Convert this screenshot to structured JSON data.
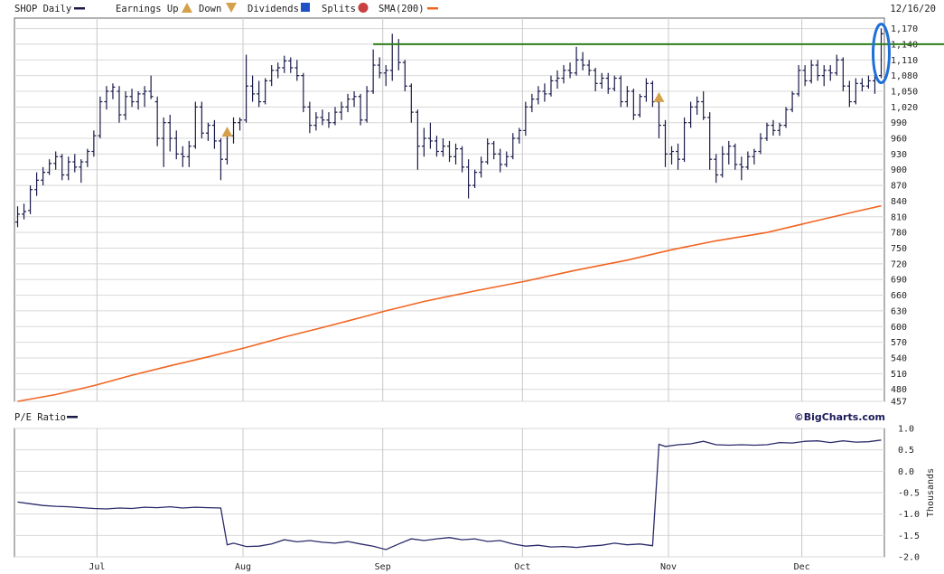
{
  "chart_data": [
    {
      "type": "ohlc",
      "legend": {
        "symbol_label": "SHOP Daily",
        "earnings_label": "Earnings Up",
        "down_label": "Down",
        "dividends_label": "Dividends",
        "splits_label": "Splits",
        "sma_label": "SMA(200)",
        "date_label": "12/16/20"
      },
      "colors": {
        "bars": "#1a1a4a",
        "sma": "#f26522",
        "resistance": "#2e7d1a",
        "highlight": "#1e6fd9",
        "earnings": "#d4a04a",
        "dividends": "#2050c8",
        "splits": "#c84040",
        "grid": "#d8d8d8"
      },
      "ylim": [
        457,
        1190
      ],
      "y_ticks": [
        457,
        480,
        510,
        540,
        570,
        600,
        630,
        660,
        690,
        720,
        750,
        780,
        810,
        840,
        870,
        900,
        930,
        960,
        990,
        1020,
        1050,
        1080,
        1110,
        1140,
        1170
      ],
      "x_months": [
        {
          "label": "Jul",
          "day": 13
        },
        {
          "label": "Aug",
          "day": 36
        },
        {
          "label": "Sep",
          "day": 58
        },
        {
          "label": "Oct",
          "day": 80
        },
        {
          "label": "Nov",
          "day": 103
        },
        {
          "label": "Dec",
          "day": 124
        }
      ],
      "num_days": 137,
      "ohlc": [
        {
          "o": 800,
          "h": 830,
          "l": 790,
          "c": 815
        },
        {
          "o": 815,
          "h": 835,
          "l": 805,
          "c": 820
        },
        {
          "o": 822,
          "h": 870,
          "l": 815,
          "c": 862
        },
        {
          "o": 862,
          "h": 895,
          "l": 850,
          "c": 880
        },
        {
          "o": 880,
          "h": 905,
          "l": 870,
          "c": 895
        },
        {
          "o": 895,
          "h": 920,
          "l": 890,
          "c": 912
        },
        {
          "o": 912,
          "h": 935,
          "l": 900,
          "c": 925
        },
        {
          "o": 925,
          "h": 930,
          "l": 880,
          "c": 890
        },
        {
          "o": 890,
          "h": 925,
          "l": 880,
          "c": 915
        },
        {
          "o": 915,
          "h": 930,
          "l": 895,
          "c": 905
        },
        {
          "o": 905,
          "h": 920,
          "l": 875,
          "c": 915
        },
        {
          "o": 915,
          "h": 940,
          "l": 905,
          "c": 935
        },
        {
          "o": 935,
          "h": 975,
          "l": 925,
          "c": 965
        },
        {
          "o": 965,
          "h": 1040,
          "l": 960,
          "c": 1030
        },
        {
          "o": 1030,
          "h": 1060,
          "l": 1015,
          "c": 1050
        },
        {
          "o": 1050,
          "h": 1065,
          "l": 1035,
          "c": 1058
        },
        {
          "o": 1050,
          "h": 1060,
          "l": 990,
          "c": 1005
        },
        {
          "o": 1005,
          "h": 1050,
          "l": 995,
          "c": 1040
        },
        {
          "o": 1040,
          "h": 1055,
          "l": 1020,
          "c": 1030
        },
        {
          "o": 1030,
          "h": 1050,
          "l": 1015,
          "c": 1045
        },
        {
          "o": 1045,
          "h": 1060,
          "l": 1020,
          "c": 1050
        },
        {
          "o": 1050,
          "h": 1080,
          "l": 1035,
          "c": 1040
        },
        {
          "o": 1030,
          "h": 1040,
          "l": 945,
          "c": 960
        },
        {
          "o": 960,
          "h": 1000,
          "l": 905,
          "c": 990
        },
        {
          "o": 990,
          "h": 1005,
          "l": 935,
          "c": 960
        },
        {
          "o": 960,
          "h": 975,
          "l": 920,
          "c": 930
        },
        {
          "o": 930,
          "h": 945,
          "l": 905,
          "c": 925
        },
        {
          "o": 925,
          "h": 955,
          "l": 905,
          "c": 945
        },
        {
          "o": 945,
          "h": 1030,
          "l": 940,
          "c": 1020
        },
        {
          "o": 1020,
          "h": 1030,
          "l": 960,
          "c": 970
        },
        {
          "o": 970,
          "h": 990,
          "l": 955,
          "c": 985
        },
        {
          "o": 985,
          "h": 995,
          "l": 940,
          "c": 955
        },
        {
          "o": 955,
          "h": 960,
          "l": 880,
          "c": 920
        },
        {
          "o": 920,
          "h": 975,
          "l": 910,
          "c": 965
        },
        {
          "o": 965,
          "h": 1000,
          "l": 950,
          "c": 990
        },
        {
          "o": 990,
          "h": 1000,
          "l": 975,
          "c": 995
        },
        {
          "o": 995,
          "h": 1120,
          "l": 990,
          "c": 1060
        },
        {
          "o": 1060,
          "h": 1080,
          "l": 1030,
          "c": 1045
        },
        {
          "o": 1045,
          "h": 1070,
          "l": 1020,
          "c": 1030
        },
        {
          "o": 1030,
          "h": 1075,
          "l": 1025,
          "c": 1070
        },
        {
          "o": 1070,
          "h": 1100,
          "l": 1060,
          "c": 1090
        },
        {
          "o": 1090,
          "h": 1105,
          "l": 1075,
          "c": 1095
        },
        {
          "o": 1095,
          "h": 1118,
          "l": 1085,
          "c": 1108
        },
        {
          "o": 1108,
          "h": 1115,
          "l": 1085,
          "c": 1095
        },
        {
          "o": 1095,
          "h": 1110,
          "l": 1070,
          "c": 1080
        },
        {
          "o": 1080,
          "h": 1085,
          "l": 1010,
          "c": 1020
        },
        {
          "o": 1020,
          "h": 1030,
          "l": 970,
          "c": 985
        },
        {
          "o": 985,
          "h": 1010,
          "l": 975,
          "c": 1000
        },
        {
          "o": 1000,
          "h": 1015,
          "l": 985,
          "c": 995
        },
        {
          "o": 995,
          "h": 1010,
          "l": 980,
          "c": 990
        },
        {
          "o": 990,
          "h": 1020,
          "l": 985,
          "c": 1010
        },
        {
          "o": 1010,
          "h": 1030,
          "l": 995,
          "c": 1020
        },
        {
          "o": 1020,
          "h": 1045,
          "l": 1010,
          "c": 1035
        },
        {
          "o": 1035,
          "h": 1050,
          "l": 1020,
          "c": 1040
        },
        {
          "o": 1040,
          "h": 1045,
          "l": 985,
          "c": 995
        },
        {
          "o": 995,
          "h": 1060,
          "l": 990,
          "c": 1050
        },
        {
          "o": 1050,
          "h": 1130,
          "l": 1045,
          "c": 1100
        },
        {
          "o": 1100,
          "h": 1115,
          "l": 1075,
          "c": 1085
        },
        {
          "o": 1085,
          "h": 1100,
          "l": 1060,
          "c": 1090
        },
        {
          "o": 1090,
          "h": 1160,
          "l": 1070,
          "c": 1140
        },
        {
          "o": 1140,
          "h": 1150,
          "l": 1090,
          "c": 1105
        },
        {
          "o": 1105,
          "h": 1110,
          "l": 1050,
          "c": 1060
        },
        {
          "o": 1060,
          "h": 1065,
          "l": 990,
          "c": 1010
        },
        {
          "o": 1010,
          "h": 1015,
          "l": 900,
          "c": 945
        },
        {
          "o": 945,
          "h": 980,
          "l": 925,
          "c": 960
        },
        {
          "o": 960,
          "h": 990,
          "l": 940,
          "c": 955
        },
        {
          "o": 955,
          "h": 965,
          "l": 925,
          "c": 935
        },
        {
          "o": 935,
          "h": 960,
          "l": 925,
          "c": 945
        },
        {
          "o": 945,
          "h": 955,
          "l": 915,
          "c": 925
        },
        {
          "o": 925,
          "h": 950,
          "l": 910,
          "c": 940
        },
        {
          "o": 940,
          "h": 945,
          "l": 895,
          "c": 905
        },
        {
          "o": 905,
          "h": 920,
          "l": 845,
          "c": 870
        },
        {
          "o": 870,
          "h": 900,
          "l": 865,
          "c": 895
        },
        {
          "o": 895,
          "h": 925,
          "l": 885,
          "c": 915
        },
        {
          "o": 915,
          "h": 960,
          "l": 910,
          "c": 950
        },
        {
          "o": 950,
          "h": 955,
          "l": 920,
          "c": 930
        },
        {
          "o": 930,
          "h": 940,
          "l": 895,
          "c": 910
        },
        {
          "o": 910,
          "h": 935,
          "l": 905,
          "c": 925
        },
        {
          "o": 925,
          "h": 970,
          "l": 920,
          "c": 960
        },
        {
          "o": 960,
          "h": 980,
          "l": 950,
          "c": 975
        },
        {
          "o": 975,
          "h": 1030,
          "l": 965,
          "c": 1020
        },
        {
          "o": 1020,
          "h": 1045,
          "l": 1010,
          "c": 1035
        },
        {
          "o": 1035,
          "h": 1060,
          "l": 1025,
          "c": 1050
        },
        {
          "o": 1050,
          "h": 1065,
          "l": 1030,
          "c": 1045
        },
        {
          "o": 1045,
          "h": 1080,
          "l": 1040,
          "c": 1070
        },
        {
          "o": 1070,
          "h": 1090,
          "l": 1055,
          "c": 1075
        },
        {
          "o": 1075,
          "h": 1100,
          "l": 1065,
          "c": 1090
        },
        {
          "o": 1090,
          "h": 1105,
          "l": 1075,
          "c": 1085
        },
        {
          "o": 1085,
          "h": 1135,
          "l": 1080,
          "c": 1110
        },
        {
          "o": 1110,
          "h": 1125,
          "l": 1090,
          "c": 1100
        },
        {
          "o": 1100,
          "h": 1110,
          "l": 1080,
          "c": 1090
        },
        {
          "o": 1090,
          "h": 1095,
          "l": 1050,
          "c": 1065
        },
        {
          "o": 1065,
          "h": 1085,
          "l": 1055,
          "c": 1075
        },
        {
          "o": 1075,
          "h": 1085,
          "l": 1045,
          "c": 1055
        },
        {
          "o": 1055,
          "h": 1080,
          "l": 1050,
          "c": 1075
        },
        {
          "o": 1075,
          "h": 1080,
          "l": 1020,
          "c": 1030
        },
        {
          "o": 1030,
          "h": 1060,
          "l": 1020,
          "c": 1050
        },
        {
          "o": 1050,
          "h": 1055,
          "l": 995,
          "c": 1005
        },
        {
          "o": 1005,
          "h": 1045,
          "l": 1000,
          "c": 1040
        },
        {
          "o": 1040,
          "h": 1075,
          "l": 1030,
          "c": 1065
        },
        {
          "o": 1065,
          "h": 1070,
          "l": 1020,
          "c": 1030
        },
        {
          "o": 1030,
          "h": 1040,
          "l": 960,
          "c": 985
        },
        {
          "o": 985,
          "h": 995,
          "l": 905,
          "c": 930
        },
        {
          "o": 930,
          "h": 945,
          "l": 910,
          "c": 935
        },
        {
          "o": 935,
          "h": 950,
          "l": 900,
          "c": 920
        },
        {
          "o": 920,
          "h": 1000,
          "l": 915,
          "c": 990
        },
        {
          "o": 990,
          "h": 1030,
          "l": 980,
          "c": 1020
        },
        {
          "o": 1020,
          "h": 1040,
          "l": 1005,
          "c": 1030
        },
        {
          "o": 1030,
          "h": 1050,
          "l": 995,
          "c": 1000
        },
        {
          "o": 1000,
          "h": 1010,
          "l": 900,
          "c": 920
        },
        {
          "o": 920,
          "h": 930,
          "l": 875,
          "c": 890
        },
        {
          "o": 890,
          "h": 945,
          "l": 885,
          "c": 930
        },
        {
          "o": 930,
          "h": 955,
          "l": 910,
          "c": 945
        },
        {
          "o": 945,
          "h": 950,
          "l": 900,
          "c": 910
        },
        {
          "o": 910,
          "h": 925,
          "l": 880,
          "c": 905
        },
        {
          "o": 905,
          "h": 935,
          "l": 900,
          "c": 925
        },
        {
          "o": 925,
          "h": 940,
          "l": 910,
          "c": 935
        },
        {
          "o": 935,
          "h": 970,
          "l": 930,
          "c": 960
        },
        {
          "o": 960,
          "h": 990,
          "l": 955,
          "c": 985
        },
        {
          "o": 985,
          "h": 995,
          "l": 965,
          "c": 975
        },
        {
          "o": 975,
          "h": 990,
          "l": 965,
          "c": 985
        },
        {
          "o": 985,
          "h": 1020,
          "l": 980,
          "c": 1015
        },
        {
          "o": 1015,
          "h": 1050,
          "l": 1010,
          "c": 1045
        },
        {
          "o": 1045,
          "h": 1100,
          "l": 1040,
          "c": 1090
        },
        {
          "o": 1090,
          "h": 1100,
          "l": 1060,
          "c": 1070
        },
        {
          "o": 1070,
          "h": 1110,
          "l": 1065,
          "c": 1100
        },
        {
          "o": 1100,
          "h": 1110,
          "l": 1070,
          "c": 1080
        },
        {
          "o": 1080,
          "h": 1100,
          "l": 1060,
          "c": 1090
        },
        {
          "o": 1090,
          "h": 1100,
          "l": 1070,
          "c": 1085
        },
        {
          "o": 1085,
          "h": 1120,
          "l": 1080,
          "c": 1110
        },
        {
          "o": 1110,
          "h": 1115,
          "l": 1050,
          "c": 1060
        },
        {
          "o": 1060,
          "h": 1070,
          "l": 1020,
          "c": 1030
        },
        {
          "o": 1030,
          "h": 1075,
          "l": 1025,
          "c": 1065
        },
        {
          "o": 1065,
          "h": 1075,
          "l": 1050,
          "c": 1060
        },
        {
          "o": 1060,
          "h": 1080,
          "l": 1055,
          "c": 1070
        },
        {
          "o": 1070,
          "h": 1085,
          "l": 1045,
          "c": 1080
        },
        {
          "o": 1080,
          "h": 1170,
          "l": 1075,
          "c": 1160
        }
      ],
      "sma": [
        {
          "day": 0,
          "value": 457
        },
        {
          "day": 6,
          "value": 470
        },
        {
          "day": 12,
          "value": 487
        },
        {
          "day": 18,
          "value": 507
        },
        {
          "day": 24,
          "value": 525
        },
        {
          "day": 30,
          "value": 542
        },
        {
          "day": 36,
          "value": 560
        },
        {
          "day": 42,
          "value": 580
        },
        {
          "day": 48,
          "value": 598
        },
        {
          "day": 54,
          "value": 617
        },
        {
          "day": 58,
          "value": 630
        },
        {
          "day": 64,
          "value": 648
        },
        {
          "day": 72,
          "value": 668
        },
        {
          "day": 80,
          "value": 687
        },
        {
          "day": 88,
          "value": 708
        },
        {
          "day": 96,
          "value": 727
        },
        {
          "day": 103,
          "value": 747
        },
        {
          "day": 110,
          "value": 764
        },
        {
          "day": 118,
          "value": 780
        },
        {
          "day": 126,
          "value": 803
        },
        {
          "day": 132,
          "value": 820
        },
        {
          "day": 136,
          "value": 831
        }
      ],
      "resistance": {
        "value": 1140,
        "start_day": 56
      },
      "highlight_day": 136,
      "earnings_markers": [
        {
          "day": 33,
          "value": 972
        },
        {
          "day": 101,
          "value": 1038
        }
      ]
    },
    {
      "type": "line",
      "title": "P/E Ratio",
      "ylabel": "Thousands",
      "ylim": [
        -2.0,
        1.0
      ],
      "y_ticks": [
        -2.0,
        -1.5,
        -1.0,
        -0.5,
        0.0,
        0.5,
        1.0
      ],
      "y_tick_labels": [
        "-2.0",
        "-1.5",
        "-1.0",
        "-0.5",
        "0.0",
        "0.5",
        "1.0"
      ],
      "x": [
        0,
        2,
        4,
        6,
        8,
        10,
        12,
        14,
        16,
        18,
        20,
        22,
        24,
        26,
        28,
        30,
        32,
        33,
        34,
        36,
        38,
        40,
        42,
        44,
        46,
        48,
        50,
        52,
        54,
        56,
        58,
        60,
        62,
        64,
        66,
        68,
        70,
        72,
        74,
        76,
        78,
        80,
        82,
        84,
        86,
        88,
        90,
        92,
        94,
        96,
        98,
        100,
        101,
        102,
        104,
        106,
        108,
        110,
        112,
        114,
        116,
        118,
        120,
        122,
        124,
        126,
        128,
        130,
        132,
        134,
        136
      ],
      "values": [
        -0.72,
        -0.76,
        -0.8,
        -0.82,
        -0.83,
        -0.85,
        -0.87,
        -0.88,
        -0.86,
        -0.87,
        -0.84,
        -0.85,
        -0.83,
        -0.86,
        -0.84,
        -0.85,
        -0.86,
        -1.72,
        -1.68,
        -1.76,
        -1.75,
        -1.7,
        -1.6,
        -1.65,
        -1.62,
        -1.66,
        -1.68,
        -1.64,
        -1.7,
        -1.75,
        -1.83,
        -1.7,
        -1.58,
        -1.62,
        -1.58,
        -1.55,
        -1.6,
        -1.58,
        -1.64,
        -1.62,
        -1.7,
        -1.75,
        -1.73,
        -1.77,
        -1.76,
        -1.78,
        -1.75,
        -1.73,
        -1.68,
        -1.72,
        -1.7,
        -1.74,
        0.63,
        0.58,
        0.62,
        0.64,
        0.7,
        0.62,
        0.61,
        0.62,
        0.61,
        0.62,
        0.67,
        0.66,
        0.7,
        0.71,
        0.67,
        0.71,
        0.68,
        0.69,
        0.73
      ]
    }
  ],
  "pe_panel": {
    "brand": "©BigCharts.com"
  }
}
